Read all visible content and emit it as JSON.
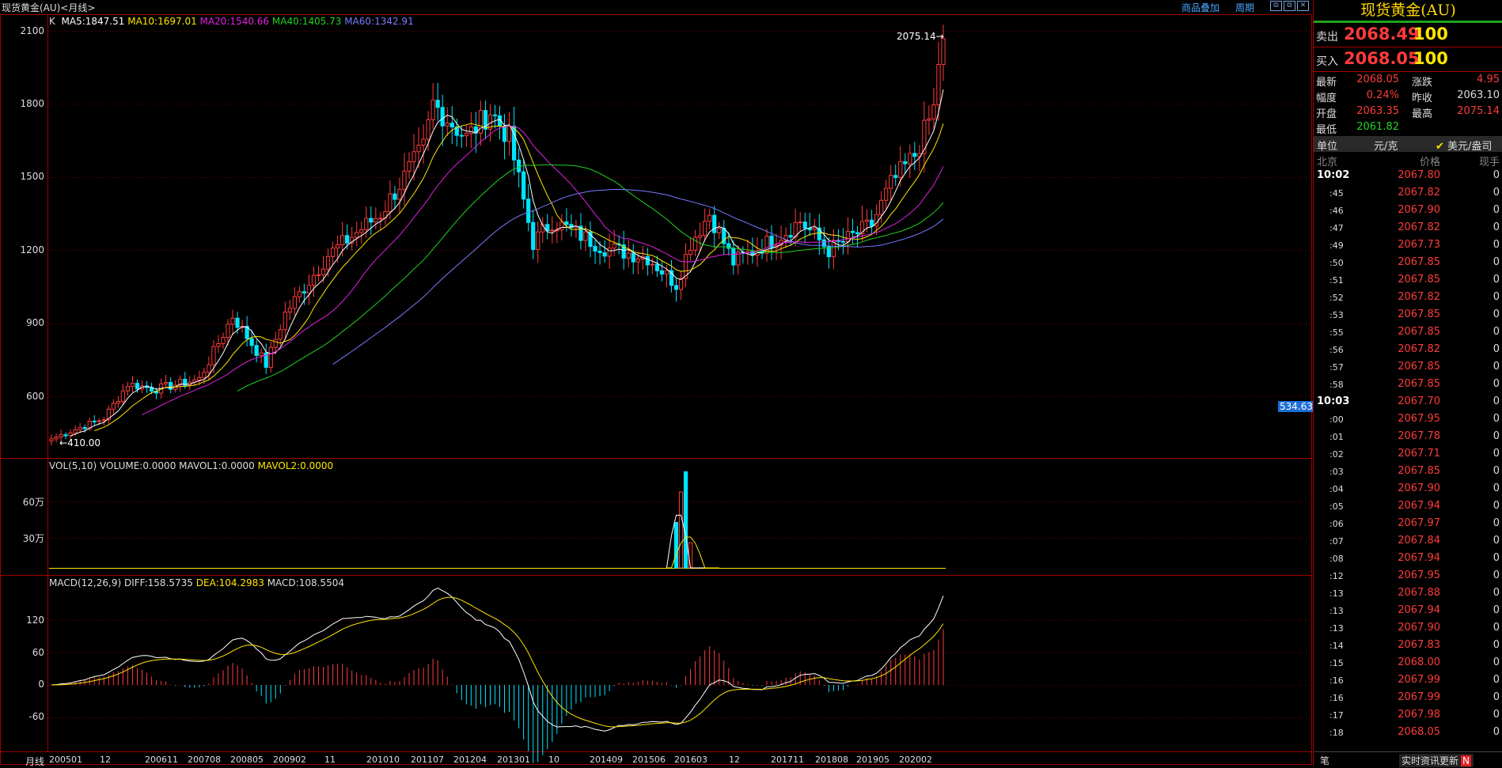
{
  "window": {
    "title": "现货黄金(AU)<月线>",
    "links": [
      "商品叠加",
      "周期"
    ],
    "window_icons": [
      "restore-icon",
      "restore-icon",
      "close-icon"
    ]
  },
  "main_chart": {
    "indicator_label": "K",
    "ma": [
      {
        "name": "MA5:1847.51",
        "color": "#ffffff"
      },
      {
        "name": "MA10:1697.01",
        "color": "#ffe600"
      },
      {
        "name": "MA20:1540.66",
        "color": "#e020e0"
      },
      {
        "name": "MA40:1405.73",
        "color": "#1fd31f"
      },
      {
        "name": "MA60:1342.91",
        "color": "#7a7aff"
      }
    ],
    "y_ticks": [
      "2100",
      "1800",
      "1500",
      "1200",
      "900",
      "600"
    ],
    "high_label": "2075.14",
    "low_label": "410.00",
    "cursor_value": "534.63"
  },
  "volume_panel": {
    "title": "VOL(5,10)",
    "items": [
      {
        "text": "VOLUME:0.0000",
        "color": "#dddddd"
      },
      {
        "text": "MAVOL1:0.0000",
        "color": "#dddddd"
      },
      {
        "text": "MAVOL2:0.0000",
        "color": "#ffe600"
      }
    ],
    "y_ticks": [
      "60万",
      "30万"
    ]
  },
  "macd_panel": {
    "title": "MACD(12,26,9)",
    "items": [
      {
        "text": "DIFF:158.5735",
        "color": "#dddddd"
      },
      {
        "text": "DEA:104.2983",
        "color": "#ffe600"
      },
      {
        "text": "MACD:108.5504",
        "color": "#dddddd"
      }
    ],
    "y_ticks": [
      "120",
      "60",
      "0",
      "-60"
    ]
  },
  "x_axis": {
    "period_label": "月线",
    "labels": [
      "200501",
      "12",
      "200611",
      "200708",
      "200805",
      "200902",
      "11",
      "201010",
      "201107",
      "201204",
      "201301",
      "10",
      "201409",
      "201506",
      "201603",
      "12",
      "201711",
      "201808",
      "201905",
      "202002"
    ]
  },
  "chart_data": {
    "type": "candlestick",
    "title": "现货黄金(AU)<月线>",
    "ylim": [
      300,
      2150
    ],
    "x_range": [
      "200501",
      "202008"
    ],
    "ma_last": {
      "MA5": 1847.51,
      "MA10": 1697.01,
      "MA20": 1540.66,
      "MA40": 1405.73,
      "MA60": 1342.91
    },
    "approx_monthly_close": [
      {
        "x": "200501",
        "close": 425
      },
      {
        "x": "200512",
        "close": 510
      },
      {
        "x": "200605",
        "close": 650
      },
      {
        "x": "200611",
        "close": 630
      },
      {
        "x": "200708",
        "close": 670
      },
      {
        "x": "200803",
        "close": 930
      },
      {
        "x": "200810",
        "close": 730
      },
      {
        "x": "200902",
        "close": 940
      },
      {
        "x": "200911",
        "close": 1180
      },
      {
        "x": "201010",
        "close": 1350
      },
      {
        "x": "201107",
        "close": 1620
      },
      {
        "x": "201109",
        "close": 1800
      },
      {
        "x": "201204",
        "close": 1660
      },
      {
        "x": "201209",
        "close": 1770
      },
      {
        "x": "201301",
        "close": 1660
      },
      {
        "x": "201306",
        "close": 1230
      },
      {
        "x": "201310",
        "close": 1320
      },
      {
        "x": "201409",
        "close": 1210
      },
      {
        "x": "201506",
        "close": 1170
      },
      {
        "x": "201512",
        "close": 1060
      },
      {
        "x": "201603",
        "close": 1230
      },
      {
        "x": "201607",
        "close": 1350
      },
      {
        "x": "201612",
        "close": 1150
      },
      {
        "x": "201711",
        "close": 1275
      },
      {
        "x": "201802",
        "close": 1320
      },
      {
        "x": "201808",
        "close": 1200
      },
      {
        "x": "201905",
        "close": 1305
      },
      {
        "x": "201909",
        "close": 1470
      },
      {
        "x": "202002",
        "close": 1590
      },
      {
        "x": "202006",
        "close": 1780
      },
      {
        "x": "202007",
        "close": 1975
      },
      {
        "x": "202008",
        "close": 2068.05
      }
    ],
    "high": 2075.14,
    "low": 410.0,
    "volume": {
      "ylim": [
        0,
        900000
      ],
      "ticks": [
        300000,
        600000
      ]
    },
    "macd": {
      "DIFF": 158.5735,
      "DEA": 104.2983,
      "MACD": 108.5504,
      "ylim": [
        -120,
        180
      ]
    }
  },
  "side_panel": {
    "title": "现货黄金(AU)",
    "sell": {
      "label": "卖出",
      "price": "2068.49",
      "vol": "100"
    },
    "buy": {
      "label": "买入",
      "price": "2068.05",
      "vol": "100"
    },
    "stats": [
      {
        "label": "最新",
        "value": "2068.05",
        "color": "#ff3b3b"
      },
      {
        "label": "涨跌",
        "value": "4.95",
        "color": "#ff3b3b"
      },
      {
        "label": "幅度",
        "value": "0.24%",
        "color": "#ff3b3b"
      },
      {
        "label": "昨收",
        "value": "2063.10",
        "color": "#dddddd"
      },
      {
        "label": "开盘",
        "value": "2063.35",
        "color": "#ff3b3b"
      },
      {
        "label": "最高",
        "value": "2075.14",
        "color": "#ff3b3b"
      },
      {
        "label": "最低",
        "value": "2061.82",
        "color": "#1fd31f"
      }
    ],
    "unit_label": "单位",
    "unit_value": "元/克",
    "currency_option": "美元/盎司",
    "ticks_header": [
      "北京",
      "价格",
      "现手"
    ],
    "ticks": [
      {
        "time": "10:02",
        "price": "2067.80",
        "vol": "0",
        "major": true
      },
      {
        "time": ":45",
        "price": "2067.82",
        "vol": "0"
      },
      {
        "time": ":46",
        "price": "2067.90",
        "vol": "0"
      },
      {
        "time": ":47",
        "price": "2067.82",
        "vol": "0"
      },
      {
        "time": ":49",
        "price": "2067.73",
        "vol": "0"
      },
      {
        "time": ":50",
        "price": "2067.85",
        "vol": "0"
      },
      {
        "time": ":51",
        "price": "2067.85",
        "vol": "0"
      },
      {
        "time": ":52",
        "price": "2067.82",
        "vol": "0"
      },
      {
        "time": ":53",
        "price": "2067.85",
        "vol": "0"
      },
      {
        "time": ":55",
        "price": "2067.85",
        "vol": "0"
      },
      {
        "time": ":56",
        "price": "2067.82",
        "vol": "0"
      },
      {
        "time": ":57",
        "price": "2067.85",
        "vol": "0"
      },
      {
        "time": ":58",
        "price": "2067.85",
        "vol": "0"
      },
      {
        "time": "10:03",
        "price": "2067.70",
        "vol": "0",
        "major": true
      },
      {
        "time": ":00",
        "price": "2067.95",
        "vol": "0"
      },
      {
        "time": ":01",
        "price": "2067.78",
        "vol": "0"
      },
      {
        "time": ":02",
        "price": "2067.71",
        "vol": "0"
      },
      {
        "time": ":03",
        "price": "2067.85",
        "vol": "0"
      },
      {
        "time": ":04",
        "price": "2067.90",
        "vol": "0"
      },
      {
        "time": ":05",
        "price": "2067.94",
        "vol": "0"
      },
      {
        "time": ":06",
        "price": "2067.97",
        "vol": "0"
      },
      {
        "time": ":07",
        "price": "2067.84",
        "vol": "0"
      },
      {
        "time": ":08",
        "price": "2067.94",
        "vol": "0"
      },
      {
        "time": ":12",
        "price": "2067.95",
        "vol": "0"
      },
      {
        "time": ":13",
        "price": "2067.88",
        "vol": "0"
      },
      {
        "time": ":13",
        "price": "2067.94",
        "vol": "0"
      },
      {
        "time": ":13",
        "price": "2067.90",
        "vol": "0"
      },
      {
        "time": ":14",
        "price": "2067.83",
        "vol": "0"
      },
      {
        "time": ":15",
        "price": "2068.00",
        "vol": "0"
      },
      {
        "time": ":16",
        "price": "2067.99",
        "vol": "0"
      },
      {
        "time": ":16",
        "price": "2067.99",
        "vol": "0"
      },
      {
        "time": ":17",
        "price": "2067.98",
        "vol": "0"
      },
      {
        "time": ":18",
        "price": "2068.05",
        "vol": "0"
      }
    ],
    "footer_left": "笔",
    "footer_news": "实时资讯更新"
  }
}
